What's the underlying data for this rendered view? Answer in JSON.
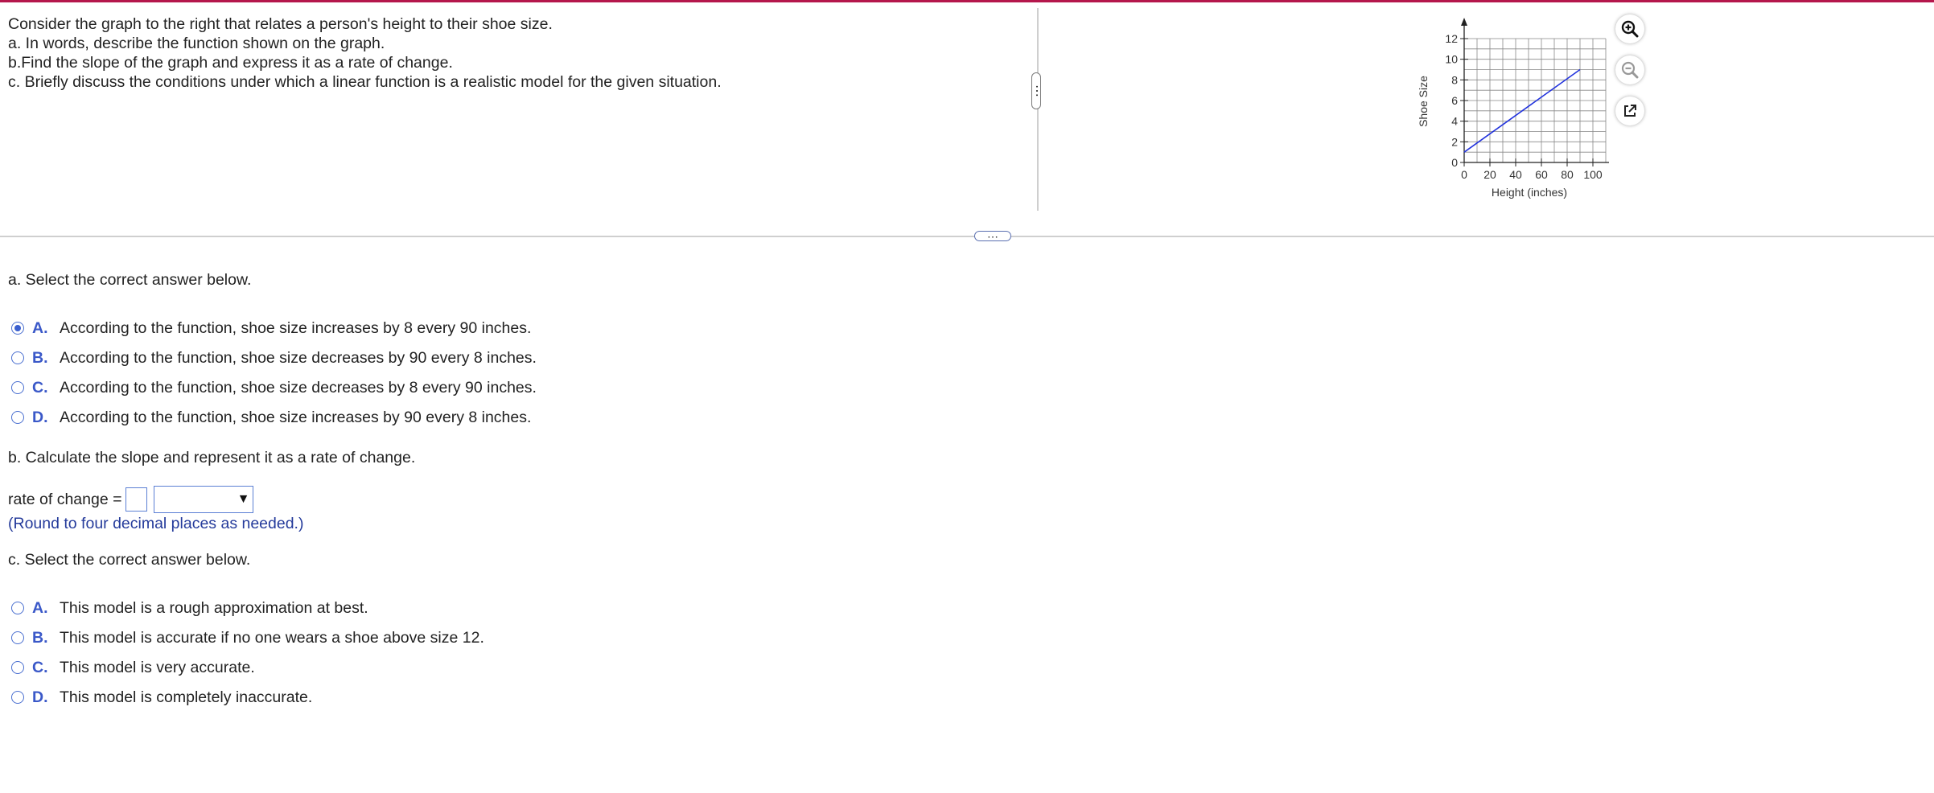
{
  "question": {
    "lines": [
      "Consider the graph to the right that relates a person's height to their shoe size.",
      "a. In words, describe the function shown on the graph.",
      "b.Find the slope of the graph and express it as a rate of change.",
      "c. Briefly discuss the conditions under which a linear function is a realistic model for the given situation."
    ]
  },
  "graph": {
    "chart_data": {
      "type": "line",
      "xlabel": "Height (inches)",
      "ylabel": "Shoe Size",
      "xlim": [
        0,
        100
      ],
      "ylim": [
        0,
        12
      ],
      "x_ticks": [
        "0",
        "20",
        "40",
        "60",
        "80",
        "100"
      ],
      "y_ticks": [
        "0",
        "2",
        "4",
        "6",
        "8",
        "10",
        "12"
      ],
      "grid": true,
      "series": [
        {
          "x": [
            0,
            90
          ],
          "y": [
            1,
            9
          ],
          "color": "#2233dd"
        }
      ]
    }
  },
  "tools": {
    "zoom_in": "zoom-in-icon",
    "zoom_out": "zoom-out-icon",
    "open_external": "external-link-icon"
  },
  "splitter_glyph": "⋯",
  "part_a": {
    "prompt": "a. Select the correct answer below.",
    "options": [
      {
        "letter": "A.",
        "text": "According to the function, shoe size increases by 8 every 90 inches.",
        "selected": true
      },
      {
        "letter": "B.",
        "text": "According to the function, shoe size decreases by 90 every 8 inches.",
        "selected": false
      },
      {
        "letter": "C.",
        "text": "According to the function, shoe size decreases by 8 every 90 inches.",
        "selected": false
      },
      {
        "letter": "D.",
        "text": "According to the function, shoe size increases by 90 every 8 inches.",
        "selected": false
      }
    ]
  },
  "part_b": {
    "prompt": "b. Calculate the slope and represent it as a rate of change.",
    "rate_label": "rate of change =",
    "answer_value": "",
    "unit_selected": "",
    "dropdown_arrow": "▼",
    "hint": "(Round to four decimal places as needed.)"
  },
  "part_c": {
    "prompt": "c. Select the correct answer below.",
    "options": [
      {
        "letter": "A.",
        "text": "This model is a rough approximation at best.",
        "selected": false
      },
      {
        "letter": "B.",
        "text": "This model is accurate if no one wears a shoe above size 12.",
        "selected": false
      },
      {
        "letter": "C.",
        "text": "This model is very accurate.",
        "selected": false
      },
      {
        "letter": "D.",
        "text": "This model is completely inaccurate.",
        "selected": false
      }
    ]
  },
  "colors": {
    "top_bar": "#b5174c",
    "option_letter": "#3a58c8",
    "hint_text": "#253b9b",
    "graph_line": "#2233dd"
  }
}
